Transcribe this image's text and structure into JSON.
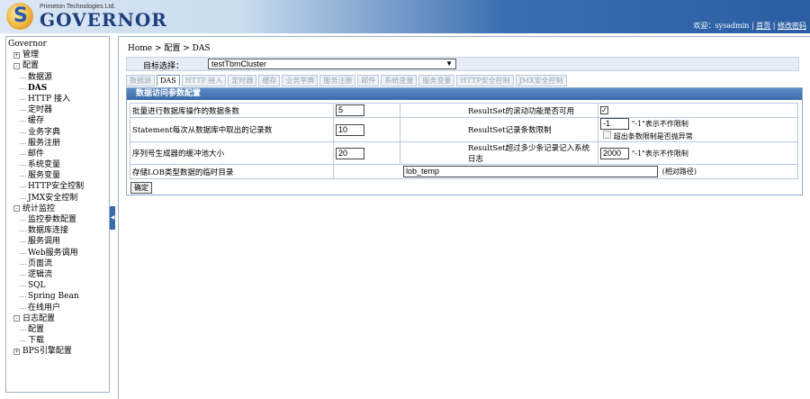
{
  "header": {
    "company": "Primeton Technologies Ltd.",
    "brand": "GOVERNOR",
    "welcome": "欢迎：sysadmin",
    "link_home": "首页",
    "link_logout": "修改密码"
  },
  "sidebar": {
    "root": "Governor",
    "groups": [
      {
        "label": "管理",
        "icon": "plus",
        "items": []
      },
      {
        "label": "配置",
        "icon": "minus",
        "items": [
          "数据源",
          "DAS",
          "HTTP 接入",
          "定时器",
          "缓存",
          "业务字典",
          "服务注册",
          "邮件",
          "系统变量",
          "服务变量",
          "HTTP安全控制",
          "JMX安全控制"
        ]
      },
      {
        "label": "统计监控",
        "icon": "minus",
        "items": [
          "监控参数配置",
          "数据库连接",
          "服务调用",
          "Web服务调用",
          "页面流",
          "逻辑流",
          "SQL",
          "Spring Bean",
          "在线用户"
        ]
      },
      {
        "label": "日志配置",
        "icon": "minus",
        "items": [
          "配置",
          "下载"
        ]
      },
      {
        "label": "BPS引擎配置",
        "icon": "plus",
        "items": []
      }
    ]
  },
  "main": {
    "breadcrumb": "Home > 配置 > DAS",
    "target_label": "目标选择：",
    "target_value": "testTbmCluster",
    "tabs": [
      "数据源",
      "DAS",
      "HTTP 接入",
      "定时器",
      "缓存",
      "业务字典",
      "服务注册",
      "邮件",
      "系统变量",
      "服务变量",
      "HTTP安全控制",
      "JMX安全控制"
    ],
    "active_tab": "DAS",
    "panel_title": "数据访问参数配置",
    "rows": {
      "r1_label": "批量进行数据库操作的数据条数",
      "r1_value": "5",
      "r1_label2": "ResultSet的滚动功能是否可用",
      "r1_checked": "✓",
      "r2_label": "Statement每次从数据库中取出的记录数",
      "r2_value": "10",
      "r2_label2": "ResultSet记录条数限制",
      "r2_value2": "-1",
      "r2_note": "\"-1\"表示不作限制",
      "r2_sub_label": "超出条数限制是否抛异常",
      "r3_label": "序列号生成器的缓冲池大小",
      "r3_value": "20",
      "r3_label2": "ResultSet超过多少条记录记入系统日志",
      "r3_value2": "2000",
      "r3_note": "\"-1\"表示不作限制",
      "r4_label": "存储LOB类型数据的临时目录",
      "r4_value": "lob_temp",
      "r4_note": "(相对路径)"
    },
    "confirm_label": "确定"
  }
}
